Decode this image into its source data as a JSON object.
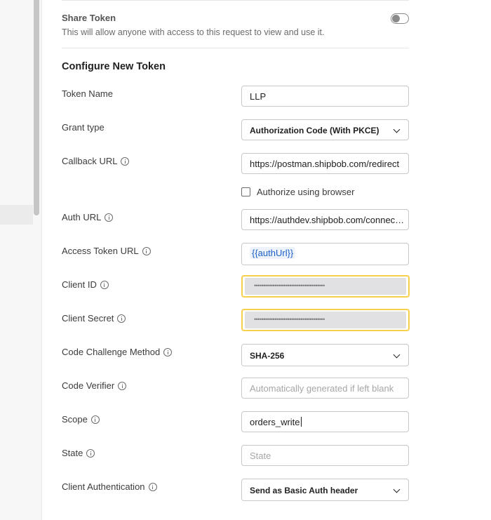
{
  "share": {
    "title": "Share Token",
    "description": "This will allow anyone with access to this request to view and use it."
  },
  "section_title": "Configure New Token",
  "fields": {
    "token_name": {
      "label": "Token Name",
      "value": "LLP"
    },
    "grant_type": {
      "label": "Grant type",
      "value": "Authorization Code (With PKCE)"
    },
    "callback_url": {
      "label": "Callback URL",
      "value": "https://postman.shipbob.com/redirect"
    },
    "authorize_browser": {
      "label": "Authorize using browser"
    },
    "auth_url": {
      "label": "Auth URL",
      "value": "https://authdev.shipbob.com/connect/authorize"
    },
    "access_token_url": {
      "label": "Access Token URL",
      "value": "{{authUrl}}"
    },
    "client_id": {
      "label": "Client ID",
      "value": "••••••••••••••••••••••••••••••••••••••"
    },
    "client_secret": {
      "label": "Client Secret",
      "value": "••••••••••••••••••••••••••••••••••••••"
    },
    "code_challenge_method": {
      "label": "Code Challenge Method",
      "value": "SHA-256"
    },
    "code_verifier": {
      "label": "Code Verifier",
      "placeholder": "Automatically generated if left blank"
    },
    "scope": {
      "label": "Scope",
      "value": "orders_write"
    },
    "state": {
      "label": "State",
      "placeholder": "State"
    },
    "client_authentication": {
      "label": "Client Authentication",
      "value": "Send as Basic Auth header"
    }
  },
  "colors": {
    "warning_border": "#f6d04d",
    "variable_text": "#1d60c7",
    "masked_bg": "#e1e1e4"
  }
}
